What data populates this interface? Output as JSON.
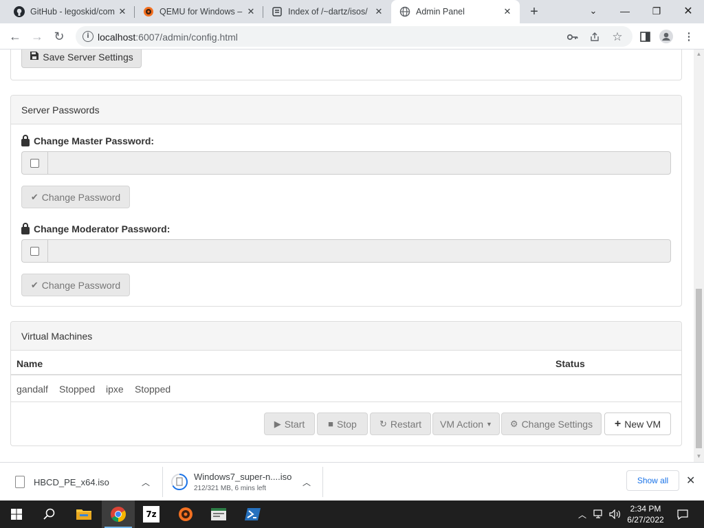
{
  "browser": {
    "tabs": [
      {
        "title": "GitHub - legoskid/com"
      },
      {
        "title": "QEMU for Windows – I"
      },
      {
        "title": "Index of /~dartz/isos/"
      },
      {
        "title": "Admin Panel"
      }
    ],
    "url_host": "localhost",
    "url_rest": ":6007/admin/config.html"
  },
  "page": {
    "save_server_settings": "Save Server Settings",
    "passwords_heading": "Server Passwords",
    "master_label": "Change Master Password:",
    "moderator_label": "Change Moderator Password:",
    "change_password": "Change Password",
    "vm_heading": "Virtual Machines",
    "table": {
      "columns": [
        "Name",
        "Status"
      ],
      "row": [
        "gandalf",
        "Stopped",
        "ipxe",
        "Stopped"
      ]
    },
    "vm_buttons": {
      "start": "Start",
      "stop": "Stop",
      "restart": "Restart",
      "vm_action": "VM Action",
      "change_settings": "Change Settings",
      "new_vm": "New VM"
    }
  },
  "downloads": {
    "items": [
      {
        "name": "HBCD_PE_x64.iso",
        "status": ""
      },
      {
        "name": "Windows7_super-n....iso",
        "status": "212/321 MB, 6 mins left"
      }
    ],
    "show_all": "Show all"
  },
  "taskbar": {
    "time": "2:34 PM",
    "date": "6/27/2022"
  }
}
